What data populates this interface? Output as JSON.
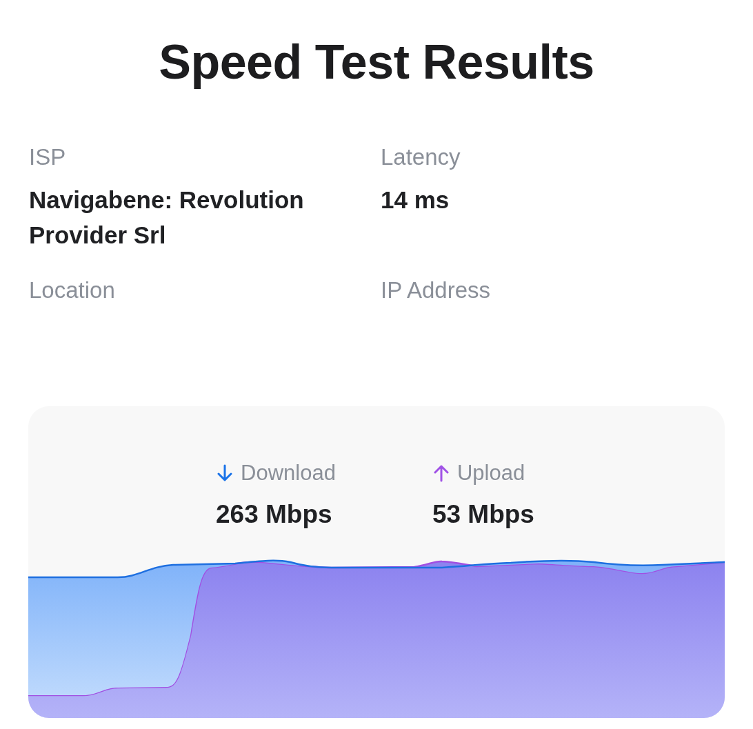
{
  "title": "Speed Test Results",
  "info": [
    {
      "label": "ISP",
      "value": "Navigabene: Revolution Provider Srl"
    },
    {
      "label": "Latency",
      "value": "14 ms"
    },
    {
      "label": "Location"
    },
    {
      "label": "IP Address"
    }
  ],
  "speeds": [
    {
      "kind": "download",
      "label": "Download",
      "value": "263 Mbps"
    },
    {
      "kind": "upload",
      "label": "Upload",
      "value": "53 Mbps"
    }
  ]
}
